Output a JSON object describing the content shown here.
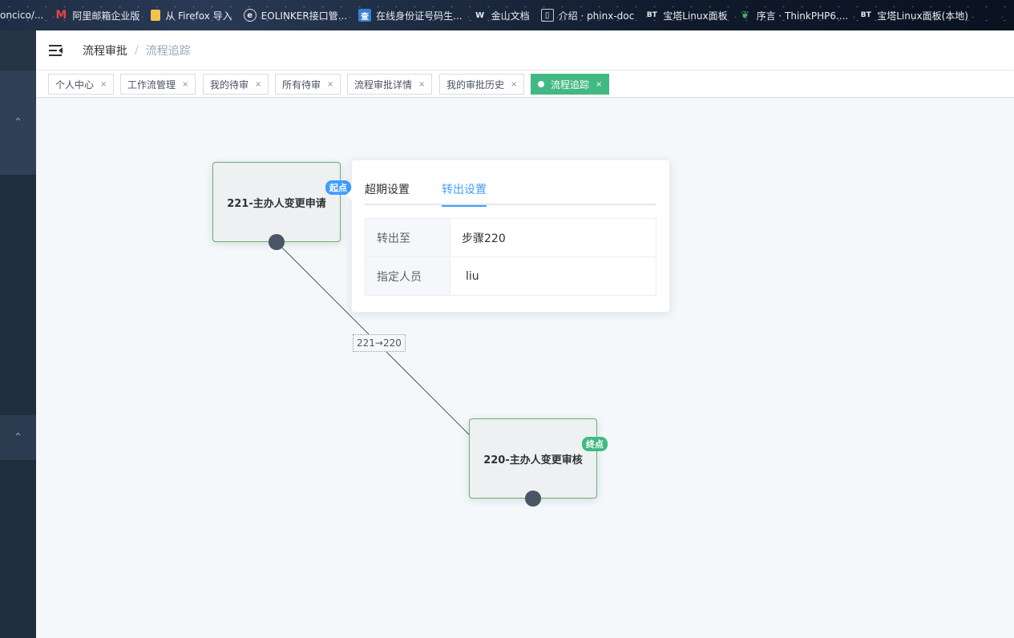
{
  "bookmarks": [
    {
      "label": "oncico/...",
      "icon": "link-icon"
    },
    {
      "label": "阿里邮箱企业版",
      "icon": "aliyun-mail-icon",
      "color": "#e94343"
    },
    {
      "label": "从 Firefox 导入",
      "icon": "folder-icon",
      "color": "#f3c24c"
    },
    {
      "label": "EOLINKER接口管...",
      "icon": "eolinker-icon"
    },
    {
      "label": "在线身份证号码生...",
      "icon": "search-badge-icon",
      "color": "#3a7fd5"
    },
    {
      "label": "金山文档",
      "icon": "kdocs-icon"
    },
    {
      "label": "介绍 · phinx-doc",
      "icon": "book-icon"
    },
    {
      "label": "宝塔Linux面板",
      "icon": "bt-icon"
    },
    {
      "label": "序言 · ThinkPHP6....",
      "icon": "leaf-icon",
      "color": "#47b36a"
    },
    {
      "label": "宝塔Linux面板(本地)",
      "icon": "bt-icon"
    }
  ],
  "breadcrumb": {
    "parent": "流程审批",
    "separator": "/",
    "current": "流程追踪"
  },
  "tags": [
    {
      "label": "个人中心",
      "active": false
    },
    {
      "label": "工作流管理",
      "active": false
    },
    {
      "label": "我的待审",
      "active": false
    },
    {
      "label": "所有待审",
      "active": false
    },
    {
      "label": "流程审批详情",
      "active": false
    },
    {
      "label": "我的审批历史",
      "active": false
    },
    {
      "label": "流程追踪",
      "active": true
    }
  ],
  "tag_close": "×",
  "flow": {
    "start_node": {
      "title": "221-主办人变更申请",
      "badge": "起点"
    },
    "end_node": {
      "title": "220-主办人变更审核",
      "badge": "终点"
    },
    "edge_label": "221→220"
  },
  "popover": {
    "tabs": [
      "超期设置",
      "转出设置"
    ],
    "active_tab": "转出设置",
    "rows": [
      {
        "key": "转出至",
        "value": "步骤220"
      },
      {
        "key": "指定人员",
        "value": "liu"
      }
    ]
  },
  "colors": {
    "accent_green": "#42b983",
    "accent_blue": "#409eff",
    "node_border": "#67b26f",
    "sidebar": "#1f2d3d"
  }
}
